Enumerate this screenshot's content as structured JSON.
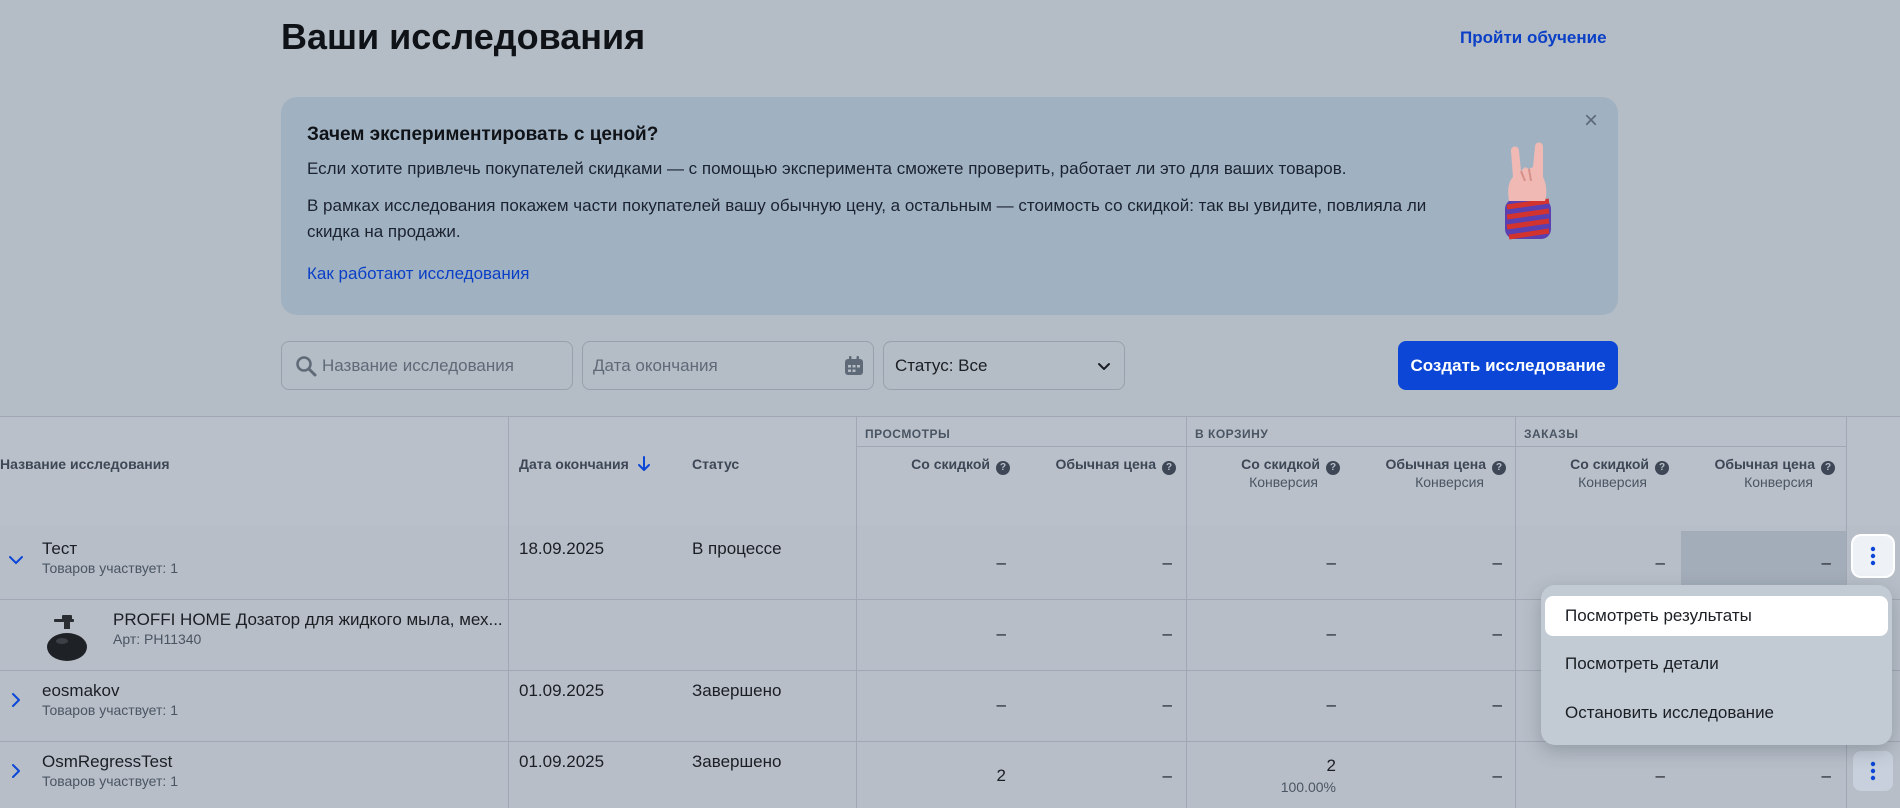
{
  "header": {
    "title": "Ваши исследования",
    "tutorial_link": "Пройти обучение"
  },
  "banner": {
    "title": "Зачем экспериментировать с ценой?",
    "p1": "Если хотите привлечь покупателей скидками — с помощью эксперимента сможете проверить, работает ли это для ваших товаров.",
    "p2": "В рамках исследования покажем части покупателей вашу обычную цену, а остальным — стоимость со скидкой: так вы увидите, повлияла ли скидка на продажи.",
    "link": "Как работают исследования"
  },
  "filters": {
    "search_placeholder": "Название исследования",
    "date_placeholder": "Дата окончания",
    "status_label": "Статус: Все"
  },
  "create_button": "Создать исследование",
  "table": {
    "groups": {
      "views": "ПРОСМОТРЫ",
      "cart": "В КОРЗИНУ",
      "orders": "ЗАКАЗЫ"
    },
    "columns": {
      "name": "Название исследования",
      "end_date": "Дата окончания",
      "status": "Статус",
      "with_discount": "Со скидкой",
      "regular_price": "Обычная цена",
      "conversion": "Конверсия"
    },
    "rows": [
      {
        "name": "Тест",
        "sub": "Товаров участвует: 1",
        "date": "18.09.2025",
        "status": "В процессе",
        "views_disc": "–",
        "views_reg": "–",
        "cart_disc": "–",
        "cart_reg": "–",
        "orders_disc": "–",
        "orders_reg": "–"
      },
      {
        "name": "PROFFI HOME Дозатор для жидкого мыла, мех...",
        "sub": "Арт: PH11340",
        "views_disc": "–",
        "views_reg": "–",
        "cart_disc": "–",
        "cart_reg": "–"
      },
      {
        "name": "eosmakov",
        "sub": "Товаров участвует: 1",
        "date": "01.09.2025",
        "status": "Завершено",
        "views_disc": "–",
        "views_reg": "–",
        "cart_disc": "–",
        "cart_reg": "–"
      },
      {
        "name": "OsmRegressTest",
        "sub": "Товаров участвует: 1",
        "date": "01.09.2025",
        "status": "Завершено",
        "views_disc": "2",
        "views_reg": "–",
        "cart_disc": "2",
        "cart_disc_conv": "100.00%",
        "cart_reg": "–",
        "orders_disc": "–",
        "orders_reg": "–"
      }
    ]
  },
  "menu": {
    "items": [
      "Посмотреть результаты",
      "Посмотреть детали",
      "Остановить исследование"
    ]
  }
}
